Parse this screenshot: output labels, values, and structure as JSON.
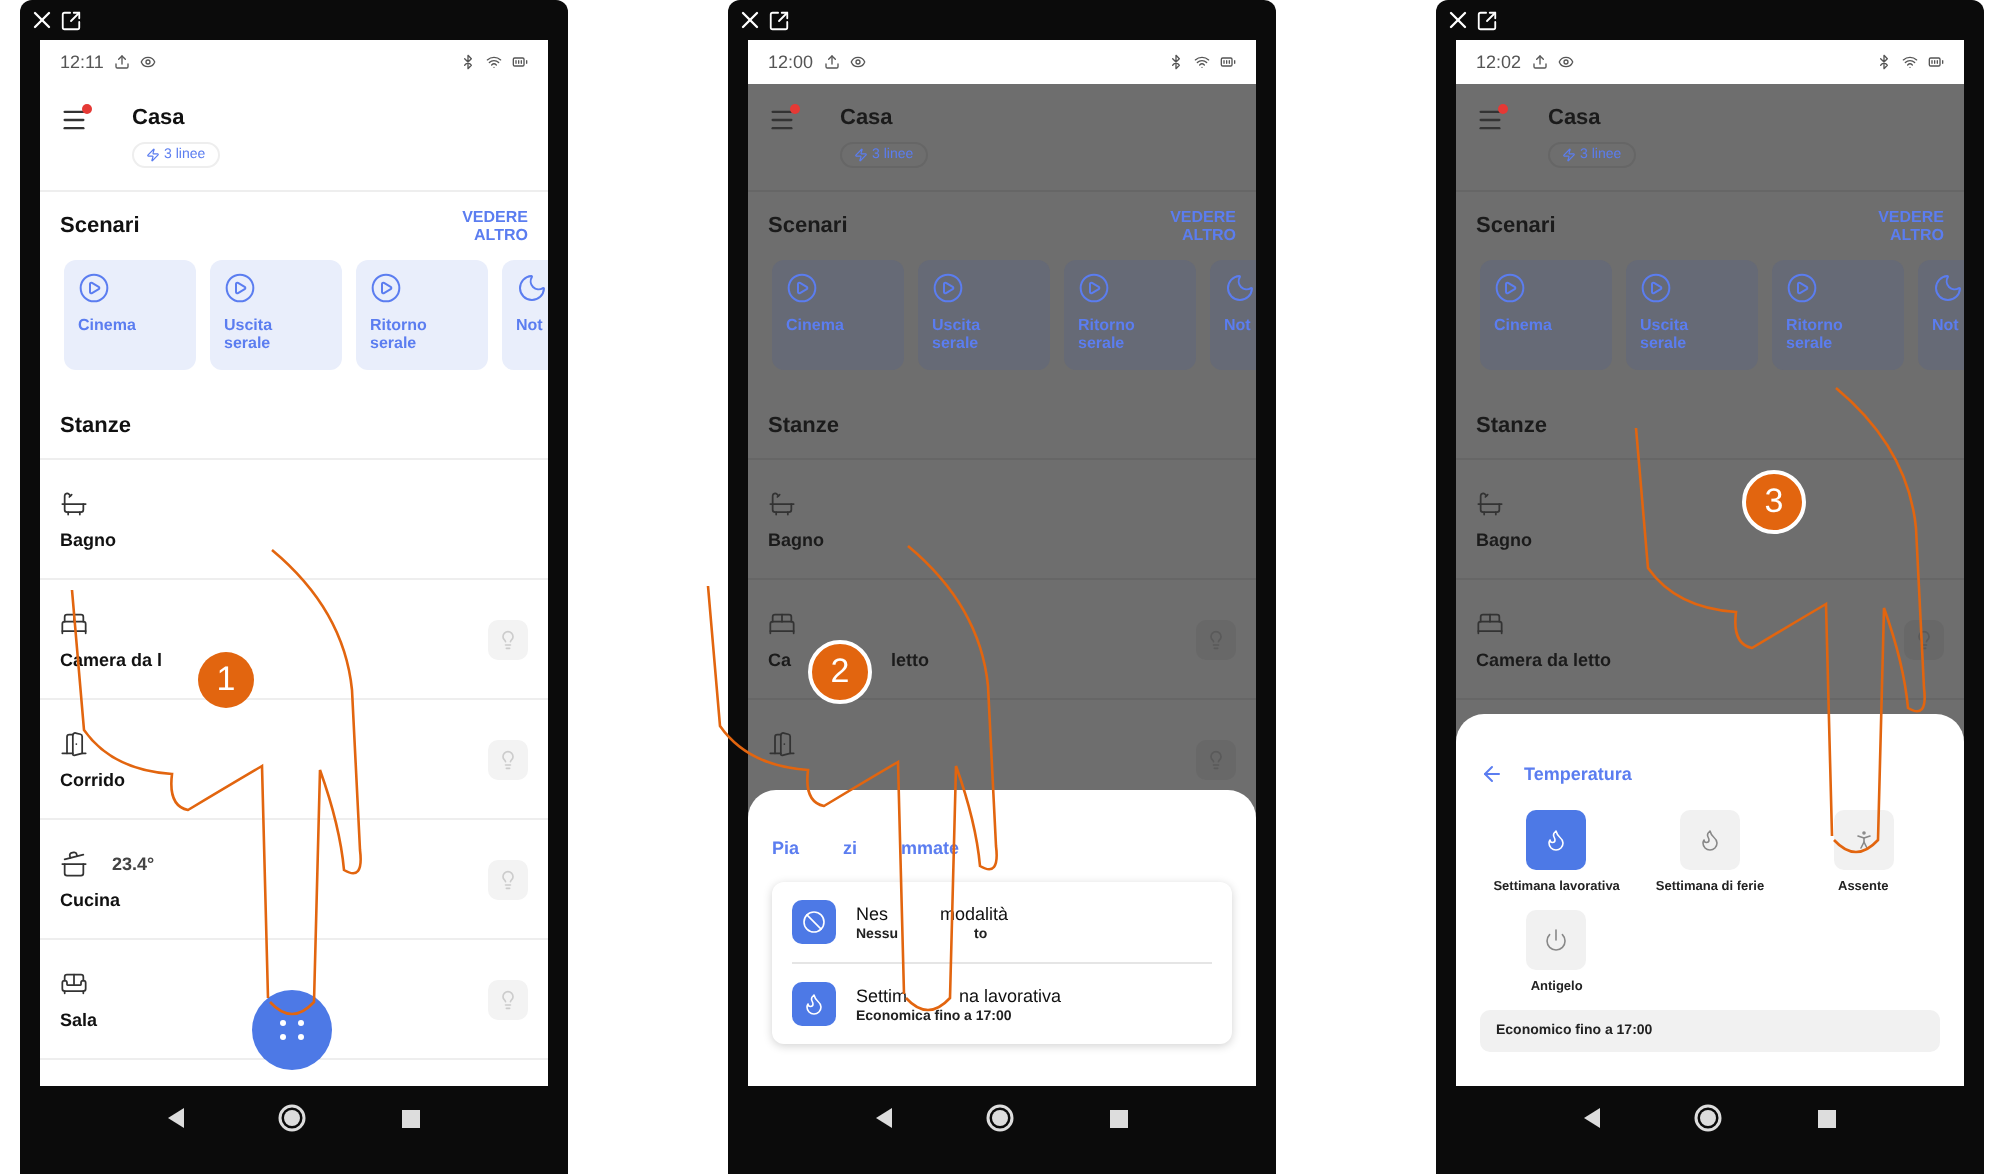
{
  "phones": [
    {
      "step": "1",
      "time": "12:11",
      "dimmed": false,
      "fab": true,
      "title": "Casa",
      "chip": "3 linee",
      "scenes_title": "Scenari",
      "see_more": "VEDERE ALTRO",
      "rooms_title": "Stanze",
      "scenes": [
        {
          "label": "Cinema",
          "kind": "play"
        },
        {
          "label": "Uscita serale",
          "kind": "play"
        },
        {
          "label": "Ritorno serale",
          "kind": "play"
        },
        {
          "label": "Not",
          "kind": "moon"
        }
      ],
      "rooms": [
        {
          "name": [
            "Bagno"
          ],
          "kind": "bath",
          "bulb": false
        },
        {
          "name": [
            "Camera da l"
          ],
          "kind": "bed",
          "bulb": true
        },
        {
          "name": [
            "Corrido"
          ],
          "kind": "door",
          "bulb": true
        },
        {
          "name": [
            "Cucina"
          ],
          "kind": "pot",
          "temp": "23.4°",
          "bulb": true
        },
        {
          "name": [
            "Sala"
          ],
          "kind": "sofa",
          "bulb": true
        }
      ]
    },
    {
      "step": "2",
      "time": "12:00",
      "dimmed": true,
      "title": "Casa",
      "chip": "3 linee",
      "scenes_title": "Scenari",
      "see_more": "VEDERE ALTRO",
      "rooms_title": "Stanze",
      "scenes": [
        {
          "label": "Cinema",
          "kind": "play"
        },
        {
          "label": "Uscita serale",
          "kind": "play"
        },
        {
          "label": "Ritorno serale",
          "kind": "play"
        },
        {
          "label": "Not",
          "kind": "moon"
        }
      ],
      "rooms": [
        {
          "name": [
            "Bagno"
          ],
          "kind": "bath",
          "bulb": false
        },
        {
          "name": [
            "Ca",
            "letto"
          ],
          "kind": "bed",
          "bulb": true
        },
        {
          "kind": "door",
          "bulb": true
        }
      ],
      "sheet": {
        "kind": "programs",
        "title": [
          "Pia",
          "zi",
          "mmate"
        ],
        "items": [
          {
            "kind": "block",
            "title": [
              "Nes",
              "modalità"
            ],
            "subtitle": [
              "Nessu",
              "to"
            ]
          },
          {
            "kind": "flame",
            "title": [
              "Settim",
              "na lavorativa"
            ],
            "subtitle": [
              "Economica fino a 17:00"
            ]
          }
        ]
      }
    },
    {
      "step": "3",
      "time": "12:02",
      "dimmed": true,
      "title": "Casa",
      "chip": "3 linee",
      "scenes_title": "Scenari",
      "see_more": "VEDERE ALTRO",
      "rooms_title": "Stanze",
      "scenes": [
        {
          "label": "Cinema",
          "kind": "play"
        },
        {
          "label": "Uscita serale",
          "kind": "play"
        },
        {
          "label": "Ritorno serale",
          "kind": "play"
        },
        {
          "label": "Not",
          "kind": "moon"
        }
      ],
      "rooms": [
        {
          "name": [
            "Bagno"
          ],
          "kind": "bath",
          "bulb": false
        },
        {
          "name": [
            "Camera da letto"
          ],
          "kind": "bed",
          "bulb": true
        }
      ],
      "sheet": {
        "kind": "temperature",
        "title": "Temperatura",
        "options": [
          {
            "label": "Settimana lavorativa",
            "kind": "flame",
            "selected": true
          },
          {
            "label": "Settimana di ferie",
            "kind": "flame",
            "selected": false
          },
          {
            "label": "Assente",
            "kind": "walk",
            "selected": false
          },
          {
            "label": "Antigelo",
            "kind": "power",
            "selected": false
          }
        ],
        "note": "Economico fino a 17:00"
      }
    }
  ]
}
